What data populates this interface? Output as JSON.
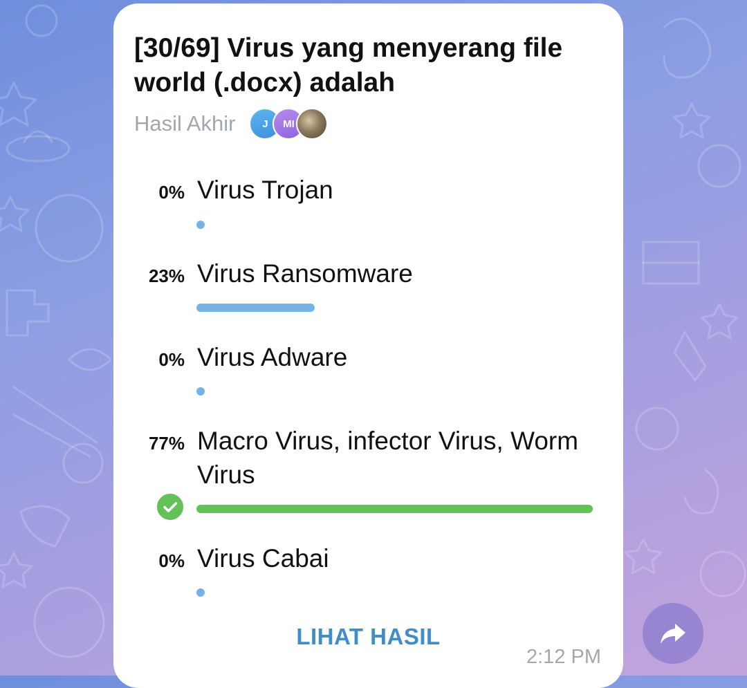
{
  "poll": {
    "question": "[30/69] Virus yang menyerang file world (.docx) adalah",
    "type_label": "Hasil Akhir",
    "voters": [
      {
        "initials": "J",
        "color": "#4a9fe3"
      },
      {
        "initials": "MI",
        "color": "#9a73e6"
      },
      {
        "initials": "",
        "color": "#8b7a5c"
      }
    ],
    "options": [
      {
        "percent_label": "0%",
        "label": "Virus Trojan",
        "fraction": 0.0,
        "correct": false
      },
      {
        "percent_label": "23%",
        "label": "Virus Ransomware",
        "fraction": 0.23,
        "correct": false
      },
      {
        "percent_label": "0%",
        "label": "Virus Adware",
        "fraction": 0.0,
        "correct": false
      },
      {
        "percent_label": "77%",
        "label": "Macro Virus, infector Virus, Worm Virus",
        "fraction": 0.77,
        "correct": true
      },
      {
        "percent_label": "0%",
        "label": "Virus Cabai",
        "fraction": 0.0,
        "correct": false
      }
    ],
    "view_results_label": "LIHAT HASIL",
    "time": "2:12 PM"
  },
  "icons": {
    "share": "share-arrow-icon",
    "correct": "check-circle-icon"
  },
  "colors": {
    "bar": "#74b3e4",
    "bar_correct": "#62c259",
    "link": "#3f8dc9",
    "muted": "#a2a7ad"
  }
}
